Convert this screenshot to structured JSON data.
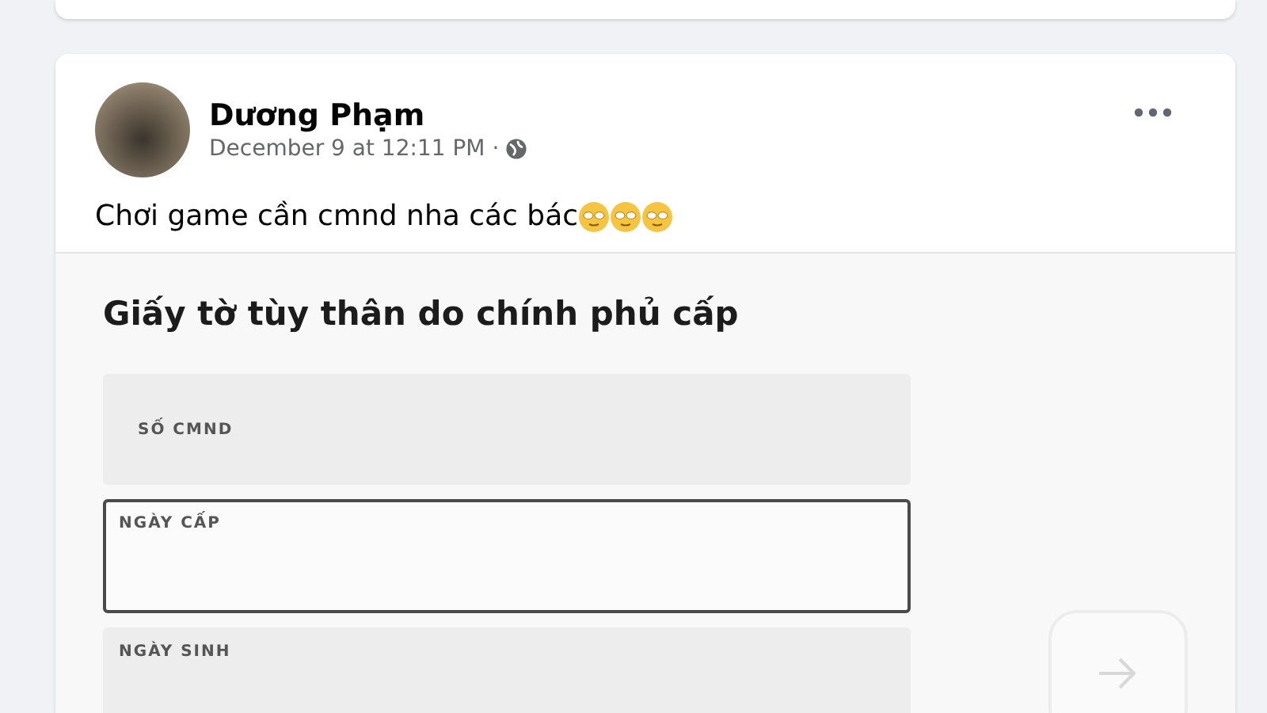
{
  "post": {
    "author": "Dương Phạm",
    "timestamp": "December 9 at 12:11 PM ·",
    "text": "Chơi game cần cmnd nha các bác",
    "reactions": [
      {
        "kind": "emoji"
      },
      {
        "kind": "emoji"
      },
      {
        "kind": "emoji"
      }
    ],
    "form": {
      "title": "Giấy tờ tùy thân do chính phủ cấp",
      "fields": [
        {
          "label": "SỐ CMND",
          "kind": "empty"
        },
        {
          "label": "NGÀY CẤP",
          "kind": "focused"
        },
        {
          "label": "NGÀY SINH",
          "kind": "filled"
        }
      ]
    }
  }
}
